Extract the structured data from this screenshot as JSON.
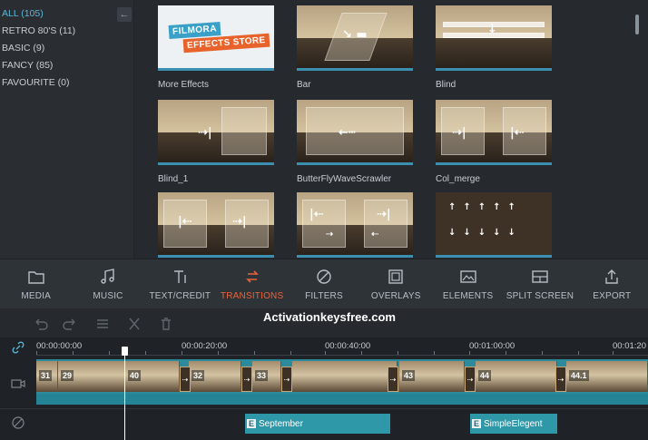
{
  "sidebar": {
    "categories": [
      {
        "label": "ALL (105)"
      },
      {
        "label": "RETRO 80'S (11)"
      },
      {
        "label": "BASIC (9)"
      },
      {
        "label": "FANCY (85)"
      },
      {
        "label": "FAVOURITE (0)"
      }
    ],
    "collapse_glyph": "←"
  },
  "effects": {
    "store_line1": "FILMORA",
    "store_line2": "EFFECTS STORE",
    "tiles": [
      {
        "label": "More Effects"
      },
      {
        "label": "Bar"
      },
      {
        "label": "Blind"
      },
      {
        "label": "Blind_1"
      },
      {
        "label": "ButterFlyWaveScrawler"
      },
      {
        "label": "Col_merge"
      }
    ]
  },
  "toolbar": {
    "items": [
      {
        "label": "MEDIA",
        "icon": "folder-icon"
      },
      {
        "label": "MUSIC",
        "icon": "music-note-icon"
      },
      {
        "label": "TEXT/CREDIT",
        "icon": "text-icon"
      },
      {
        "label": "TRANSITIONS",
        "icon": "transitions-icon"
      },
      {
        "label": "FILTERS",
        "icon": "filters-icon"
      },
      {
        "label": "OVERLAYS",
        "icon": "overlays-icon"
      },
      {
        "label": "ELEMENTS",
        "icon": "elements-icon"
      },
      {
        "label": "SPLIT SCREEN",
        "icon": "split-screen-icon"
      },
      {
        "label": "EXPORT",
        "icon": "export-icon"
      }
    ],
    "active": "TRANSITIONS",
    "active_color": "#e8633b"
  },
  "watermark": "Activationkeysfree.com",
  "timeline": {
    "timecodes": [
      "00:00:00:00",
      "00:00:20:00",
      "00:00:40:00",
      "00:01:00:00",
      "00:01:20"
    ],
    "clip_numbers": [
      "31",
      "29",
      "40",
      "32",
      "33",
      "43",
      "44",
      "44.1"
    ],
    "text_clips": [
      {
        "tag": "E",
        "label": "September"
      },
      {
        "tag": "E",
        "label": "SimpleElegent"
      }
    ],
    "track_color": "#2b8a9c"
  },
  "colors": {
    "accent": "#3b8fb0",
    "active_category": "#5ab6d9",
    "background": "#262a2f"
  }
}
